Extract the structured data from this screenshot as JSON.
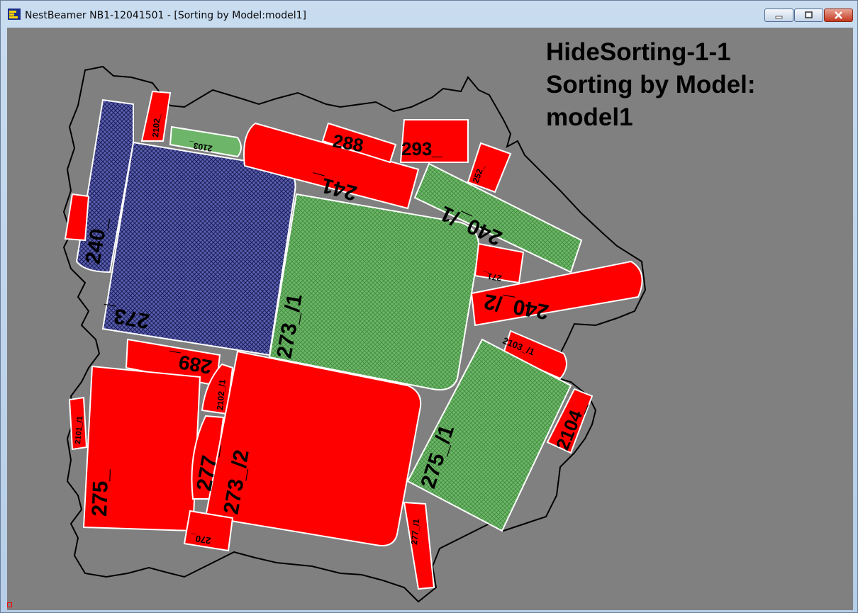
{
  "window": {
    "title": "NestBeamer NB1-12041501 - [Sorting by Model:model1]",
    "icon": "nestbeamer-app-icon",
    "controls": [
      "minimize-icon",
      "restore-icon",
      "close-icon"
    ]
  },
  "canvas": {
    "background_color": "#808080",
    "heading_line1": "HideSorting-1-1",
    "heading_line2": "Sorting by Model:",
    "heading_line3": "model1"
  },
  "pieces": {
    "p273": "273_",
    "p240": "240_",
    "p2102": "2102_",
    "p2103": "2103_",
    "p288": "288",
    "p293": "293_",
    "p241": "241_",
    "p252": "252_",
    "p240_1": "240_/1",
    "p273_1": "273_/1",
    "p271": "271_",
    "p240_2": "240_/2",
    "p2103_1": "2103_/1",
    "p289": "289_",
    "p2102_1": "2102_/1",
    "p275": "275_",
    "p2101_1": "2101_/1",
    "p277": "277_",
    "p273_2": "273_/2",
    "p270": "270_",
    "p275_1": "275_/1",
    "p2104": "2104_",
    "p277_1": "277_/1",
    "p_small": "2101_"
  },
  "colors": {
    "red_piece": "#ff0000",
    "green_piece": "#5fa35a",
    "blue_piece": "#4a4f9e",
    "outline": "#ffffff"
  }
}
